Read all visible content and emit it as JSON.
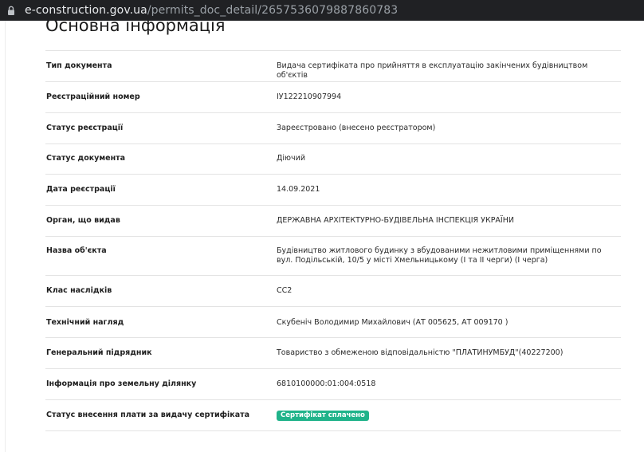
{
  "browser": {
    "url_host": "e-construction.gov.ua",
    "url_path": "/permits_doc_detail/2657536079887860783",
    "lock_icon": "lock-icon"
  },
  "section": {
    "title": "Основна інформація"
  },
  "rows": [
    {
      "label": "Тип документа",
      "value": "Видача сертифіката про прийняття в експлуатацію закінчених будівництвом об'єктів"
    },
    {
      "label": "Реєстраційний номер",
      "value": "ІУ122210907994"
    },
    {
      "label": "Статус реєстрації",
      "value": "Зареєстровано (внесено реєстратором)"
    },
    {
      "label": "Статус документа",
      "value": "Діючий"
    },
    {
      "label": "Дата реєстрації",
      "value": "14.09.2021"
    },
    {
      "label": "Орган, що видав",
      "value": "ДЕРЖАВНА АРХІТЕКТУРНО-БУДІВЕЛЬНА ІНСПЕКЦІЯ УКРАЇНИ"
    },
    {
      "label": "Назва об'єкта",
      "value": "Будівництво житлового будинку з вбудованими нежитловими приміщеннями по вул. Подільській, 10/5 у місті Хмельницькому (І та ІІ черги) (І черга)"
    },
    {
      "label": "Клас наслідків",
      "value": "СС2"
    },
    {
      "label": "Технічний нагляд",
      "value": "Скубеніч Володимир Михайлович (АТ 005625, АТ 009170 )"
    },
    {
      "label": "Генеральний підрядник",
      "value": "Товариство з обмеженою відповідальністю \"ПЛАТИНУМБУД\"(40227200)"
    },
    {
      "label": "Інформація про земельну ділянку",
      "value": "6810100000:01:004:0518"
    },
    {
      "label": "Статус внесення плати за видачу сертифіката",
      "badge": "Сертифікат сплачено"
    }
  ],
  "colors": {
    "badge_bg": "#20b38a",
    "url_bar_bg": "#202124"
  }
}
